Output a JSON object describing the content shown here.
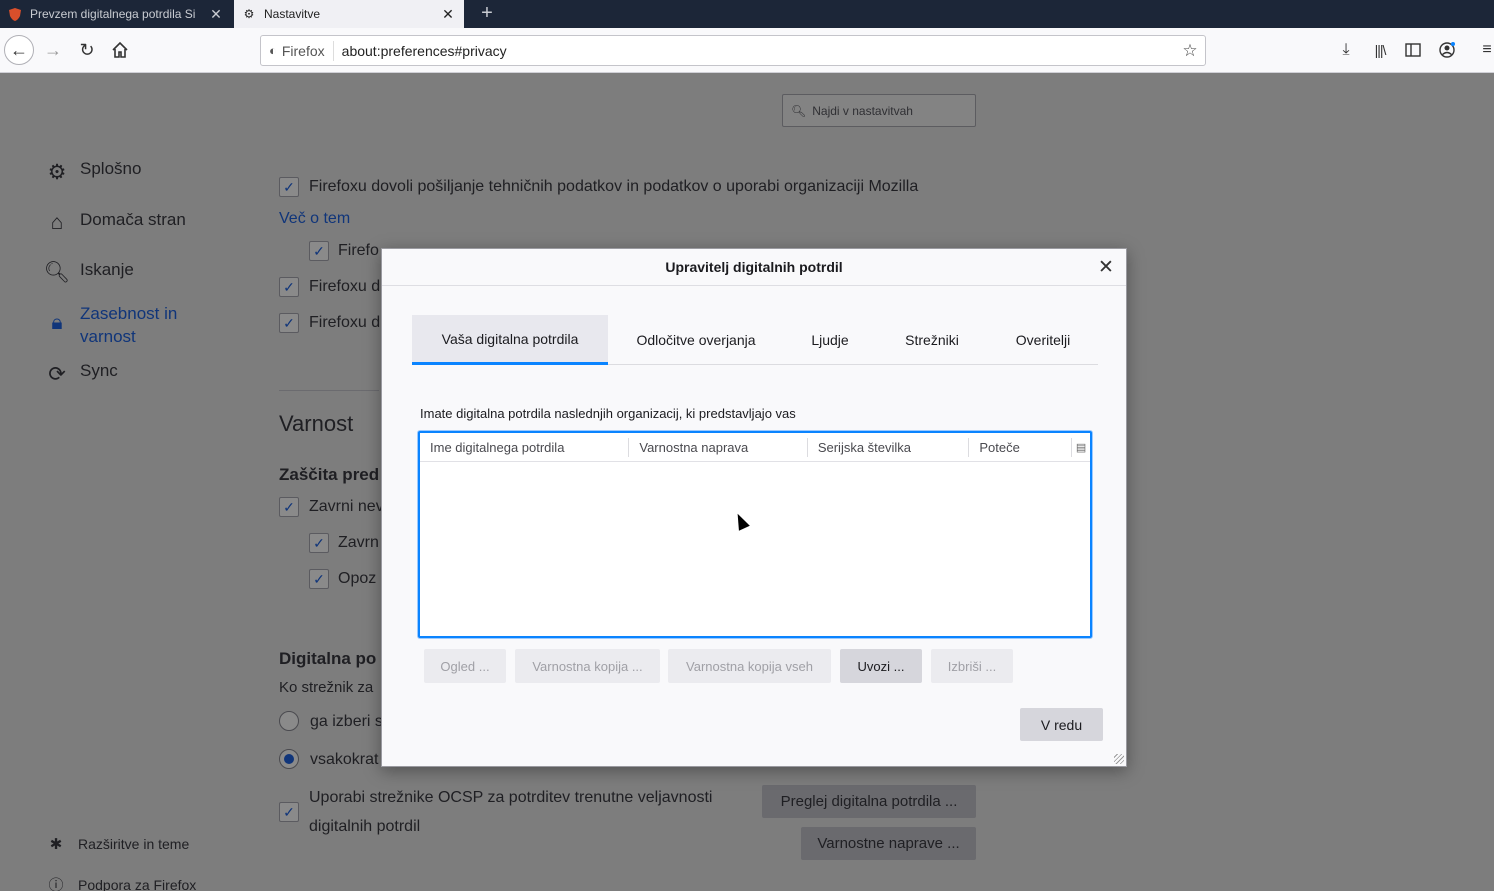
{
  "browser": {
    "tabs": [
      {
        "title": "Prevzem digitalnega potrdila Si",
        "active": false,
        "favicon": "shield-favicon"
      },
      {
        "title": "Nastavitve",
        "active": true,
        "favicon": "gear-icon"
      }
    ],
    "new_tab": "+",
    "tab_close": "✕",
    "identity_label": "Firefox",
    "url": "about:preferences#privacy"
  },
  "prefs": {
    "search_placeholder": "Najdi v nastavitvah",
    "categories": [
      {
        "label": "Splošno",
        "icon": "gear-icon"
      },
      {
        "label": "Domača stran",
        "icon": "home-icon"
      },
      {
        "label": "Iskanje",
        "icon": "search-icon"
      },
      {
        "label": "Zasebnost in varnost",
        "icon": "lock-icon"
      },
      {
        "label": "Sync",
        "icon": "sync-icon"
      }
    ],
    "footer_links": [
      {
        "label": "Razširitve in teme",
        "icon": "puzzle-icon"
      },
      {
        "label": "Podpora za Firefox",
        "icon": "help-icon"
      }
    ],
    "telemetry_label": "Firefoxu dovoli pošiljanje tehničnih podatkov in podatkov o uporabi organizaciji Mozilla",
    "learn_more": "Več o tem",
    "sub_option_1": "Firefo",
    "sub_option_2": "Firefoxu d",
    "sub_option_3": "Firefoxu d",
    "security_heading": "Varnost",
    "protection_heading": "Zaščita pred",
    "block_label": "Zavrni nev",
    "block_sub_1": "Zavrn",
    "block_sub_2": "Opoz",
    "certs_heading": "Digitalna po",
    "certs_question": "Ko strežnik za",
    "radio_auto": "ga izberi s",
    "radio_ask": "vsakokrat",
    "ocsp_label_1": "Uporabi strežnike OCSP za potrditev trenutne veljavnosti",
    "ocsp_label_2": "digitalnih potrdil",
    "view_certs_button": "Preglej digitalna potrdila ...",
    "security_devices_button": "Varnostne naprave ..."
  },
  "dialog": {
    "title": "Upravitelj digitalnih potrdil",
    "tabs": [
      "Vaša digitalna potrdila",
      "Odločitve overjanja",
      "Ljudje",
      "Strežniki",
      "Overitelji"
    ],
    "selected_tab": 0,
    "description": "Imate digitalna potrdila naslednjih organizacij, ki predstavljajo vas",
    "columns": [
      "Ime digitalnega potrdila",
      "Varnostna naprava",
      "Serijska številka",
      "Poteče"
    ],
    "rows": [],
    "buttons": [
      {
        "label": "Ogled ...",
        "enabled": false
      },
      {
        "label": "Varnostna kopija ...",
        "enabled": false
      },
      {
        "label": "Varnostna kopija vseh",
        "enabled": false
      },
      {
        "label": "Uvozi ...",
        "enabled": true
      },
      {
        "label": "Izbriši ...",
        "enabled": false
      }
    ],
    "ok_button": "V redu",
    "accent": "#0a84ff"
  }
}
